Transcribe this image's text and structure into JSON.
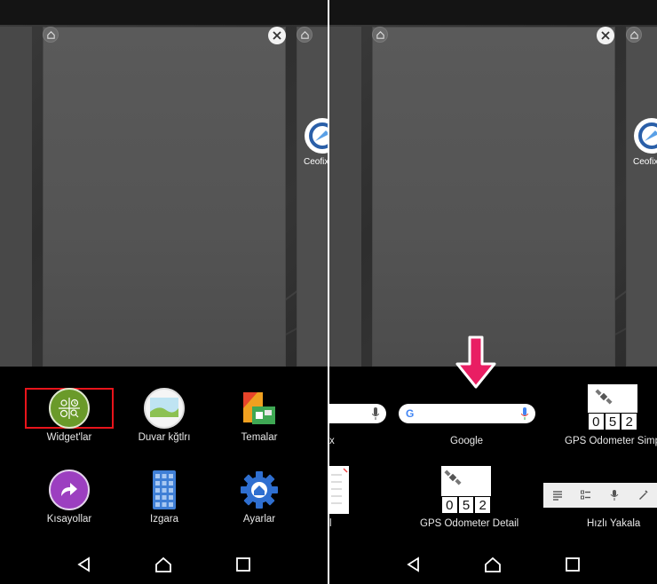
{
  "left": {
    "ceofix_label": "Ceofix.",
    "drawer": {
      "row1": [
        {
          "label": "Widget'lar",
          "icon": "widgets-icon"
        },
        {
          "label": "Duvar kğtlrı",
          "icon": "wallpaper-icon"
        },
        {
          "label": "Temalar",
          "icon": "themes-icon"
        }
      ],
      "row2": [
        {
          "label": "Kısayollar",
          "icon": "shortcut-arrow-icon"
        },
        {
          "label": "Izgara",
          "icon": "grid-icon"
        },
        {
          "label": "Ayarlar",
          "icon": "settings-gear-icon"
        }
      ]
    }
  },
  "right": {
    "ceofix_label": "Ceofix.",
    "widgets": {
      "partial_left_label": "x",
      "google_label": "Google",
      "google_letter": "G",
      "gps_simple_label": "GPS Odometer Simple",
      "partial_left_label2": "l",
      "gps_detail_label": "GPS Odometer Detail",
      "hizli_label": "Hızlı Yakala",
      "odometer_digits": [
        "0",
        "5",
        "2"
      ]
    }
  },
  "colors": {
    "highlight": "#e8141b",
    "arrow": "#e91e63",
    "widgets_green": "#6a9a2a",
    "shortcut_purple": "#9c3fc0",
    "grid_blue": "#3f7fd6",
    "settings_blue": "#2f6fd0"
  }
}
